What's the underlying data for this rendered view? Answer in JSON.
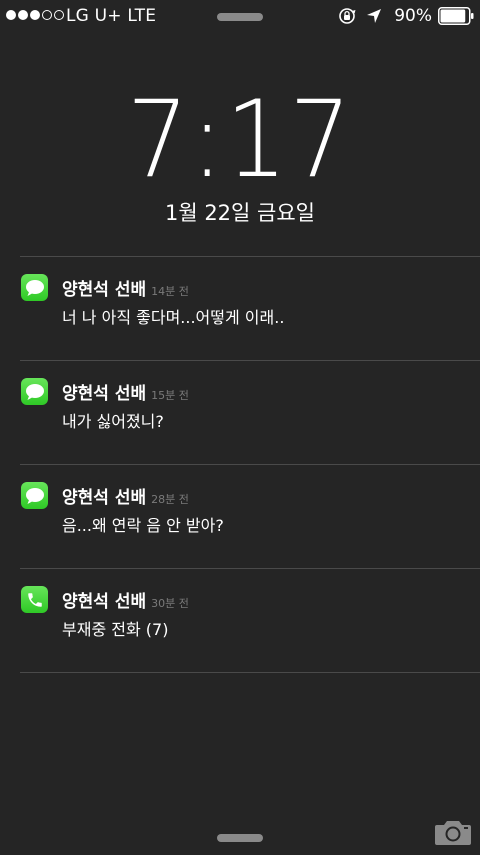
{
  "status_bar": {
    "signal_dots_filled": 3,
    "signal_dots_total": 5,
    "carrier": "LG U+  LTE",
    "battery_percent": "90%",
    "battery_level": 0.9,
    "icons": [
      "rotation-lock-icon",
      "location-arrow-icon",
      "battery-icon"
    ]
  },
  "lock_screen": {
    "time": "7:17",
    "date": "1월 22일 금요일"
  },
  "notifications": [
    {
      "app_icon": "message-icon",
      "sender": "양현석 선배",
      "time": "14분 전",
      "message": "너 나 아직 좋다며...어떻게 이래.."
    },
    {
      "app_icon": "message-icon",
      "sender": "양현석 선배",
      "time": "15분 전",
      "message": "내가 싫어졌니?"
    },
    {
      "app_icon": "message-icon",
      "sender": "양현석 선배",
      "time": "28분 전",
      "message": "음...왜 연락 음 안 받아?"
    },
    {
      "app_icon": "phone-icon",
      "sender": "양현석 선배",
      "time": "30분 전",
      "message": "부재중 전화 (7)"
    }
  ],
  "colors": {
    "background": "#252525",
    "app_icon_green": "#3fd136",
    "divider": "#4a4a4a",
    "secondary_text": "#7a7a7a"
  },
  "bottom": {
    "camera_icon": "camera-icon"
  }
}
